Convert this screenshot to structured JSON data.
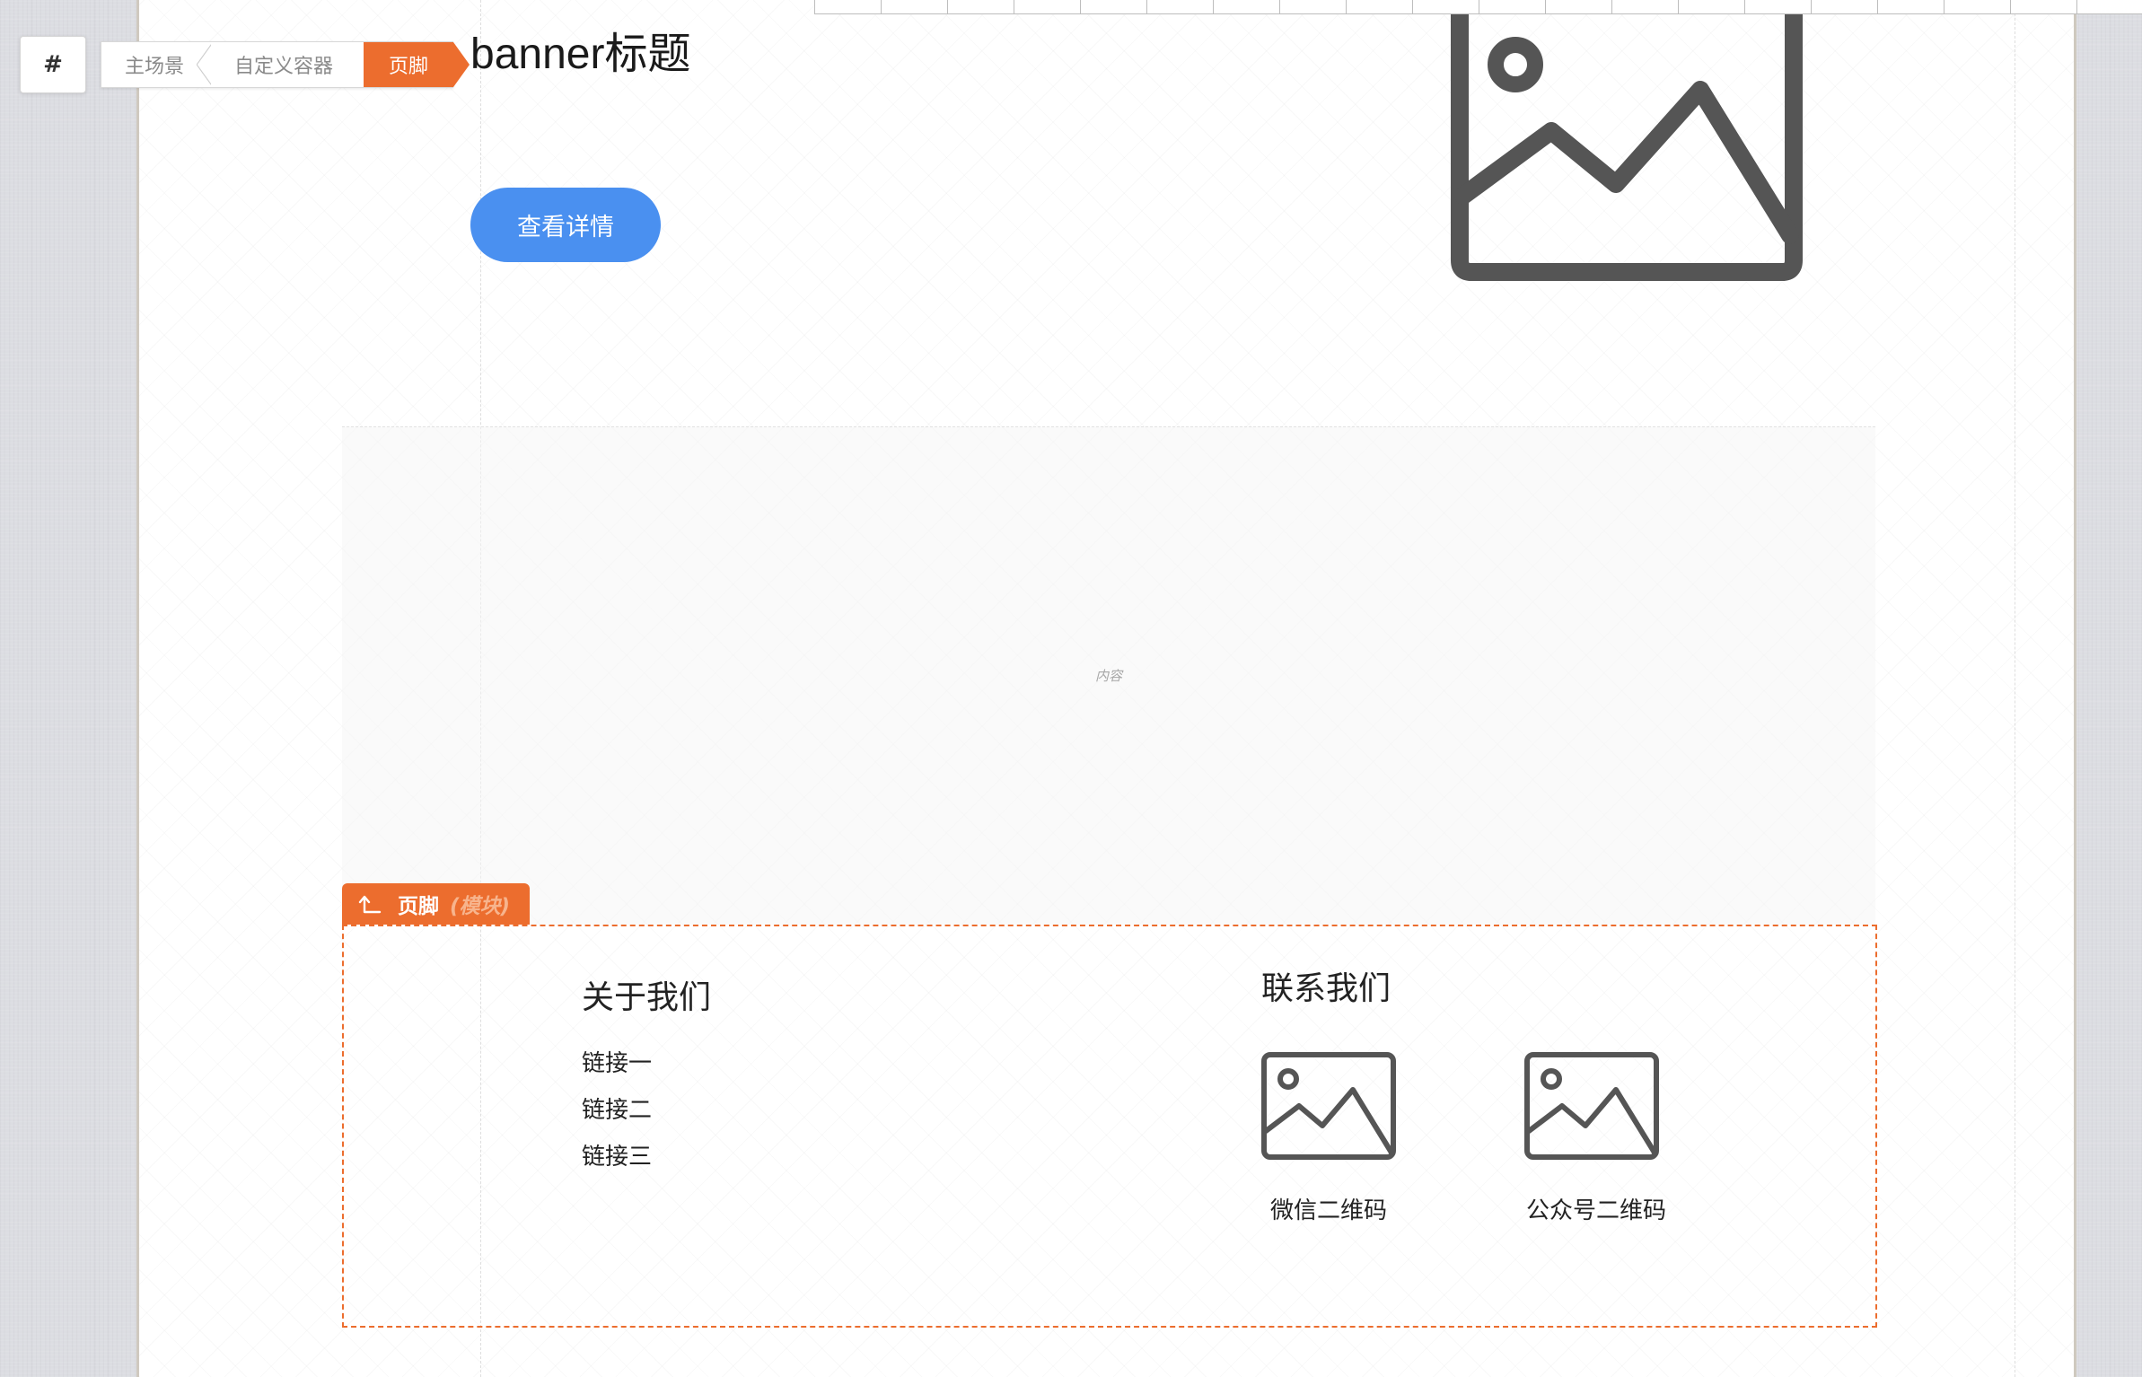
{
  "toolbar": {
    "hash_label": "#"
  },
  "breadcrumb": {
    "items": [
      {
        "label": "主场景"
      },
      {
        "label": "自定义容器"
      },
      {
        "label": "页脚"
      }
    ]
  },
  "banner": {
    "title": "banner标题",
    "button_label": "查看详情",
    "image_icon": "image-placeholder-icon"
  },
  "content": {
    "placeholder": "内容"
  },
  "module_tag": {
    "icon": "arrow-up-left-icon",
    "name": "页脚",
    "type": "(模块)"
  },
  "footer": {
    "about": {
      "title": "关于我们",
      "links": [
        "链接一",
        "链接二",
        "链接三"
      ]
    },
    "contact": {
      "title": "联系我们",
      "qrcodes": [
        {
          "caption": "微信二维码",
          "icon": "image-placeholder-icon"
        },
        {
          "caption": "公众号二维码",
          "icon": "image-placeholder-icon"
        }
      ]
    }
  },
  "colors": {
    "accent": "#ec6d2e",
    "primary_button": "#4a90f0",
    "icon_gray": "#555555"
  }
}
